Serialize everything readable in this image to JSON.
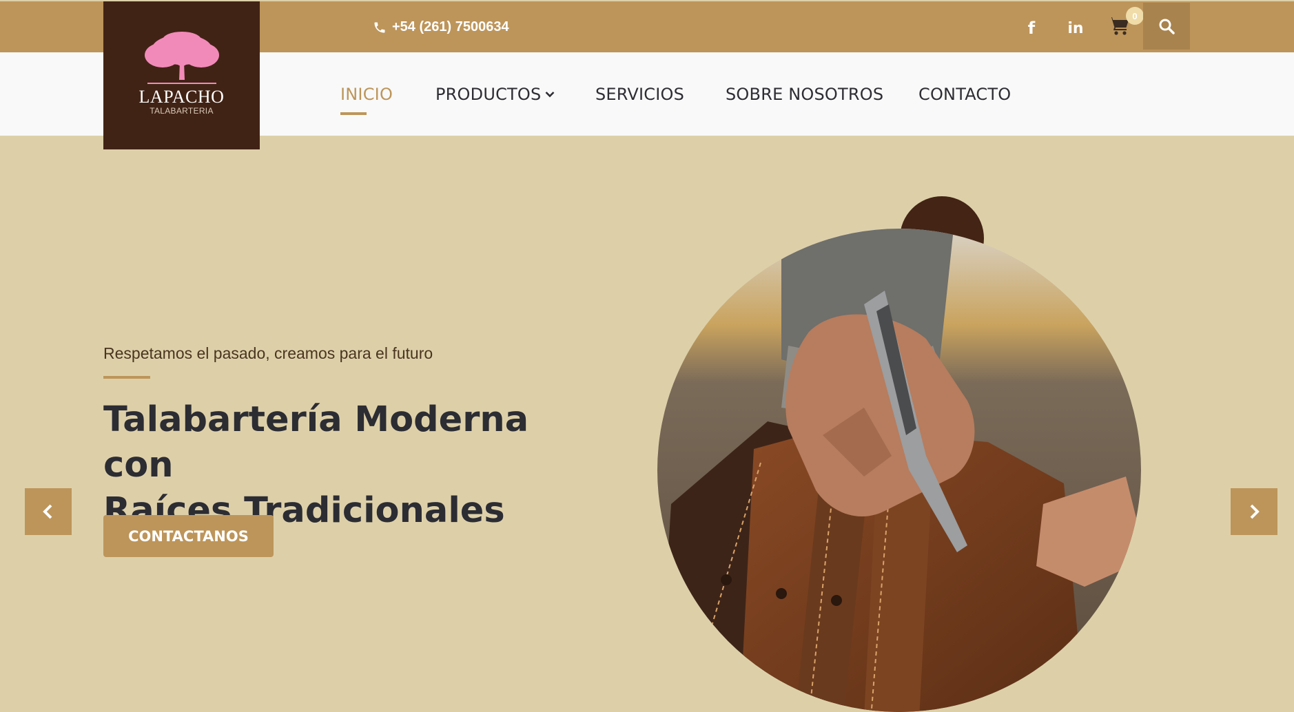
{
  "header": {
    "phone": "+54 (261) 7500634",
    "social": {
      "facebook": "f",
      "linkedin": "in"
    },
    "cart_count": "0"
  },
  "logo": {
    "name": "LAPACHO",
    "subtitle": "TALABARTERIA"
  },
  "nav": {
    "items": [
      {
        "label": "INICIO",
        "active": true
      },
      {
        "label": "PRODUCTOS",
        "dropdown": true
      },
      {
        "label": "SERVICIOS"
      },
      {
        "label": "SOBRE NOSOTROS"
      },
      {
        "label": "CONTACTO"
      }
    ]
  },
  "hero": {
    "subtitle": "Respetamos el pasado, creamos para el futuro",
    "title_line1": "Talabartería Moderna con",
    "title_line2": "Raíces Tradicionales",
    "cta_label": "CONTACTANOS"
  },
  "colors": {
    "topbar": "#bd955a",
    "accent": "#bd955a",
    "hero_bg": "#ddd0a9",
    "logo_bg": "#412315",
    "logo_tree": "#f28ab9",
    "title_text": "#2c2c33"
  }
}
